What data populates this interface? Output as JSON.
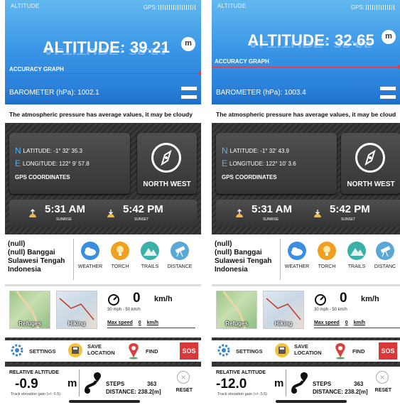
{
  "screens": [
    {
      "app_label": "ALTITUDE",
      "gps_label": "GPS:",
      "altitude_text": "ALTITUDE: 39.21",
      "altitude_unit": "m",
      "accuracy_label": "ACCURACY GRAPH",
      "barometer_text": "BAROMETER (hPa): 1002.1",
      "forecast_text": "The atmospheric pressure has average values, it may be cloudy",
      "latitude_text": "LATITUDE: -1° 32' 35.3",
      "longitude_text": "LONGITUDE: 122° 9' 57.8",
      "gps_coordinates_label": "GPS COORDINATES",
      "direction_text": "NORTH WEST",
      "sunrise_time": "5:31 AM",
      "sunrise_label": "SUNRISE",
      "sunset_time": "5:42 PM",
      "sunset_label": "SUNSET",
      "location_line1": "(null)",
      "location_line2": "(null) Banggai Sulawesi Tengah Indonesia",
      "weather_label": "WEATHER",
      "torch_label": "TORCH",
      "trails_label": "TRAILS",
      "distance_label": "DISTANCE",
      "refuges_label": "Refuges",
      "hiking_label": "Hiking",
      "speed_value": "0",
      "speed_unit": "km/h",
      "speed_range": "30 mph - 50 km/h",
      "max_speed_label": "Max speed",
      "max_speed_value": "0",
      "max_speed_unit": "km/h",
      "settings_label": "SETTINGS",
      "save_location_label": "SAVE LOCATION",
      "find_label": "FIND",
      "sos_label": "SOS",
      "relative_altitude_label": "RELATIVE ALTITUDE",
      "relative_altitude_value": "-0.9",
      "relative_altitude_unit": "m",
      "track_note": "Track elevation gain (+/- 0.5)",
      "steps_label": "STEPS",
      "steps_value": "363",
      "distance_text": "DISTANCE: 238.2[m]",
      "reset_label": "RESET"
    },
    {
      "app_label": "ALTITUDE",
      "gps_label": "GPS:",
      "altitude_text": "ALTITUDE: 32.65",
      "altitude_unit": "m",
      "accuracy_label": "ACCURACY GRAPH",
      "barometer_text": "BAROMETER (hPa): 1003.4",
      "forecast_text": "The atmospheric pressure has average values, it may be cloud",
      "latitude_text": "LATITUDE: -1° 32' 43.9",
      "longitude_text": "LONGITUDE: 122° 10' 3.6",
      "gps_coordinates_label": "GPS COORDINATES",
      "direction_text": "NORTH WEST",
      "sunrise_time": "5:31 AM",
      "sunrise_label": "SUNRISE",
      "sunset_time": "5:42 PM",
      "sunset_label": "SUNSET",
      "location_line1": "(null)",
      "location_line2": "(null) Banggai Sulawesi Tengah Indonesia",
      "weather_label": "WEATHER",
      "torch_label": "TORCH",
      "trails_label": "TRAILS",
      "distance_label": "DISTANC",
      "refuges_label": "Refuges",
      "hiking_label": "Hiking",
      "speed_value": "0",
      "speed_unit": "km/h",
      "speed_range": "30 mph - 50 km/h",
      "max_speed_label": "Max speed",
      "max_speed_value": "0",
      "max_speed_unit": "km/h",
      "settings_label": "SETTINGS",
      "save_location_label": "SAVE LOCATION",
      "find_label": "FIND",
      "sos_label": "SOS",
      "relative_altitude_label": "RELATIVE ALTITUDE",
      "relative_altitude_value": "-12.0",
      "relative_altitude_unit": "m",
      "track_note": "Track elevation gain (+/- 0.5)",
      "steps_label": "STEPS",
      "steps_value": "363",
      "distance_text": "DISTANCE: 238.2[m]",
      "reset_label": "RESET"
    }
  ],
  "colors": {
    "header_blue": "#3a96e6",
    "accent_blue": "#4fb4f2",
    "accuracy_line_red": "#e13b48",
    "sos_red": "#d93838",
    "weather_blue": "#3b8ee0",
    "torch_orange": "#f0a020",
    "trails_teal": "#3ab0a8",
    "distance_blue": "#5aa8d8",
    "find_red": "#d9413a"
  },
  "icons": [
    "gear-icon",
    "save-icon",
    "map-pin-icon",
    "compass-icon",
    "sunrise-icon",
    "sunset-icon",
    "weather-icon",
    "torch-icon",
    "trails-icon",
    "telescope-icon",
    "speedometer-icon",
    "route-path-icon",
    "reset-x-icon",
    "menu-icon"
  ]
}
